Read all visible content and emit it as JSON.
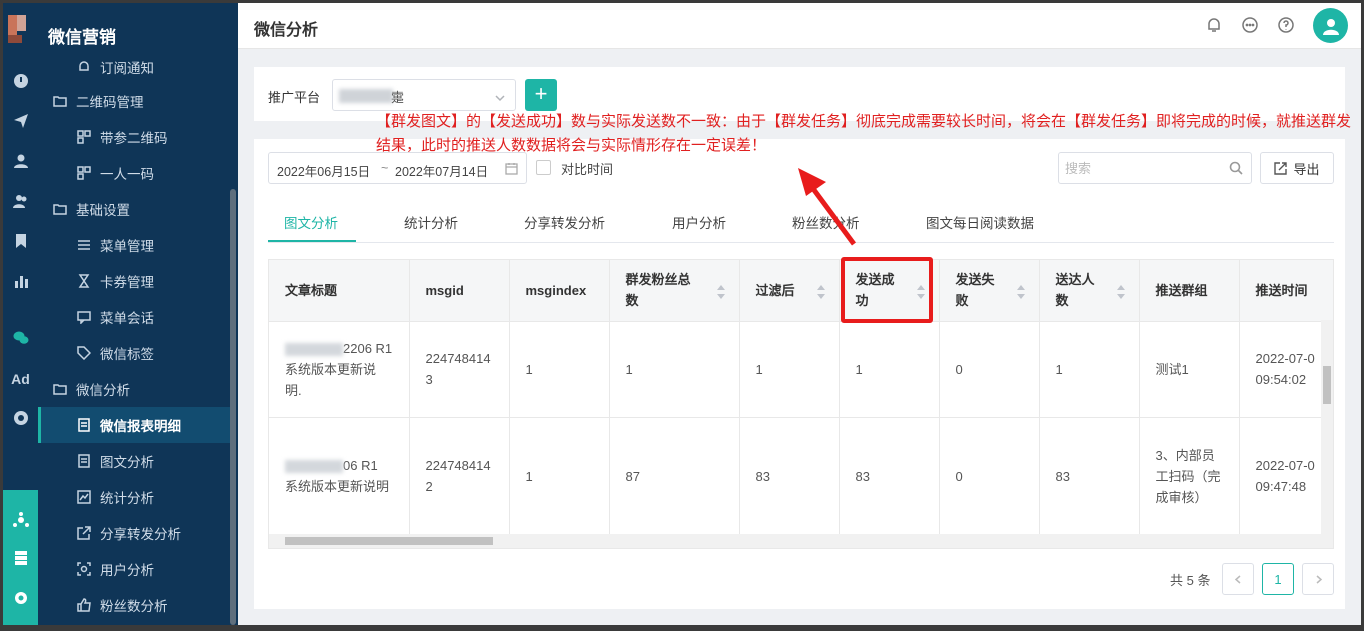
{
  "sidebar": {
    "title": "微信营销",
    "items": [
      {
        "label": "订阅通知"
      },
      {
        "label": "二维码管理"
      },
      {
        "label": "带参二维码"
      },
      {
        "label": "一人一码"
      },
      {
        "label": "基础设置"
      },
      {
        "label": "菜单管理"
      },
      {
        "label": "卡券管理"
      },
      {
        "label": "菜单会话"
      },
      {
        "label": "微信标签"
      },
      {
        "label": "微信分析"
      },
      {
        "label": "微信报表明细"
      },
      {
        "label": "图文分析"
      },
      {
        "label": "统计分析"
      },
      {
        "label": "分享转发分析"
      },
      {
        "label": "用户分析"
      },
      {
        "label": "粉丝数分析"
      }
    ]
  },
  "rail": {
    "ad_label": "Ad"
  },
  "header": {
    "title": "微信分析"
  },
  "filter": {
    "platform_label": "推广平台",
    "platform_value_suffix": "疐",
    "add_label": "+"
  },
  "date_range": {
    "start": "2022年06月15日",
    "sep": "~",
    "end": "2022年07月14日"
  },
  "compare_label": "对比时间",
  "search": {
    "placeholder": "搜索"
  },
  "export_label": "导出",
  "tabs": [
    {
      "label": "图文分析"
    },
    {
      "label": "统计分析"
    },
    {
      "label": "分享转发分析"
    },
    {
      "label": "用户分析"
    },
    {
      "label": "粉丝数分析"
    },
    {
      "label": "图文每日阅读数据"
    }
  ],
  "table": {
    "headers": [
      "文章标题",
      "msgid",
      "msgindex",
      "群发粉丝总数",
      "过滤后",
      "发送成功",
      "发送失败",
      "送达人数",
      "推送群组",
      "推送时间"
    ],
    "rows": [
      {
        "title_visible": "2206 R1 系统版本更新说明.",
        "msgid": "2247484143",
        "msgindex": "1",
        "fans": "1",
        "filtered": "1",
        "success": "1",
        "fail": "0",
        "delivered": "1",
        "group": "测试1",
        "time": "2022-07-0 09:54:02"
      },
      {
        "title_visible": "06 R1 系统版本更新说明",
        "msgid": "2247484142",
        "msgindex": "1",
        "fans": "87",
        "filtered": "83",
        "success": "83",
        "fail": "0",
        "delivered": "83",
        "group": "3、内部员工扫码（完成审核）",
        "time": "2022-07-0 09:47:48"
      }
    ]
  },
  "pagination": {
    "total": "共 5 条",
    "current": "1"
  },
  "annotation": {
    "text": "【群发图文】的【发送成功】数与实际发送数不一致：由于【群发任务】彻底完成需要较长时间，将会在【群发任务】即将完成的时候，就推送群发结果，此时的推送人数数据将会与实际情形存在一定误差！"
  },
  "colors": {
    "accent": "#1eb5a6",
    "sidebar_bg": "#0f3557",
    "annotation": "#e02020"
  }
}
